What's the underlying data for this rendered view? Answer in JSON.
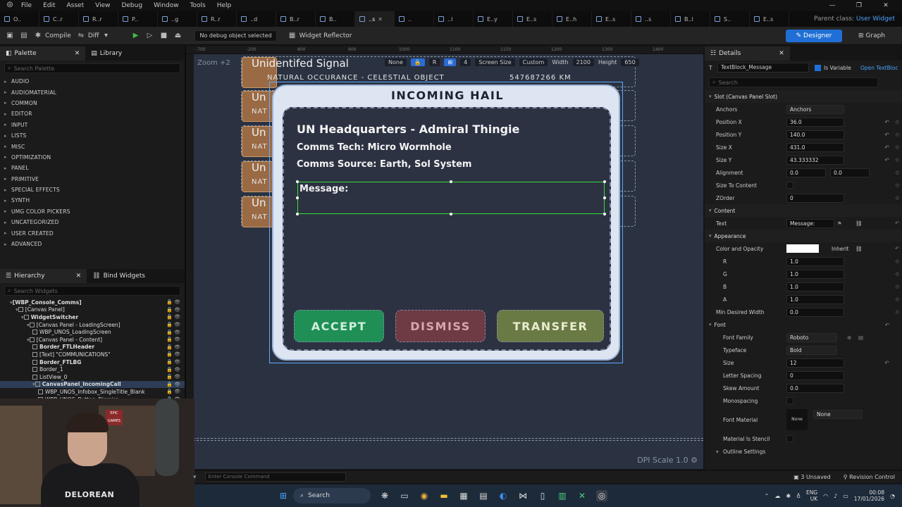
{
  "menubar": {
    "items": [
      "File",
      "Edit",
      "Asset",
      "View",
      "Debug",
      "Window",
      "Tools",
      "Help"
    ]
  },
  "tabs": [
    {
      "label": "O..",
      "active": false
    },
    {
      "label": "C..r",
      "active": false
    },
    {
      "label": "R..r",
      "active": false
    },
    {
      "label": "P..",
      "active": false
    },
    {
      "label": "..g",
      "active": false
    },
    {
      "label": "R..r",
      "active": false
    },
    {
      "label": "..d",
      "active": false
    },
    {
      "label": "B..r",
      "active": false
    },
    {
      "label": "B..",
      "active": false
    },
    {
      "label": "..s",
      "active": true
    },
    {
      "label": "..",
      "active": false
    },
    {
      "label": "..l",
      "active": false
    },
    {
      "label": "E..y",
      "active": false
    },
    {
      "label": "E..s",
      "active": false
    },
    {
      "label": "E..h",
      "active": false
    },
    {
      "label": "E..s",
      "active": false
    },
    {
      "label": "..s",
      "active": false
    },
    {
      "label": "B..l",
      "active": false
    },
    {
      "label": "S..",
      "active": false
    },
    {
      "label": "E..s",
      "active": false
    }
  ],
  "parent_class": {
    "label": "Parent class:",
    "value": "User Widget"
  },
  "toolbar": {
    "compile": "Compile",
    "diff": "Diff",
    "debug_select": "No debug object selected",
    "widget_reflector": "Widget Reflector",
    "designer": "Designer",
    "graph": "Graph"
  },
  "palette": {
    "tab": "Palette",
    "library_tab": "Library",
    "search_placeholder": "Search Palette",
    "categories": [
      "AUDIO",
      "AUDIOMATERIAL",
      "COMMON",
      "EDITOR",
      "INPUT",
      "LISTS",
      "MISC",
      "OPTIMIZATION",
      "PANEL",
      "PRIMITIVE",
      "SPECIAL EFFECTS",
      "SYNTH",
      "UMG COLOR PICKERS",
      "UNCATEGORIZED",
      "USER CREATED",
      "ADVANCED"
    ]
  },
  "hierarchy": {
    "tab": "Hierarchy",
    "bind_tab": "Bind Widgets",
    "search_placeholder": "Search Widgets",
    "rows": [
      {
        "label": "[WBP_Console_Comms]",
        "indent": 0,
        "bold": true
      },
      {
        "label": "[Canvas Panel]",
        "indent": 1,
        "bold": false
      },
      {
        "label": "WidgetSwitcher",
        "indent": 2,
        "bold": true
      },
      {
        "label": "[Canvas Panel - LoadingScreen]",
        "indent": 3,
        "bold": false
      },
      {
        "label": "WBP_UNOS_LoadingScreen",
        "indent": 4,
        "bold": false
      },
      {
        "label": "[Canvas Panel - Content]",
        "indent": 3,
        "bold": false
      },
      {
        "label": "Border_FTLHeader",
        "indent": 4,
        "bold": true
      },
      {
        "label": "[Text] \"COMMUNICATIONS\"",
        "indent": 4,
        "bold": false
      },
      {
        "label": "Border_FTLBG",
        "indent": 4,
        "bold": true
      },
      {
        "label": "Border_1",
        "indent": 4,
        "bold": false
      },
      {
        "label": "ListView_0",
        "indent": 4,
        "bold": false
      },
      {
        "label": "CanvasPanel_IncomingCall",
        "indent": 4,
        "bold": true
      },
      {
        "label": "WBP_UNOS_Infobox_SingleTitle_Blank",
        "indent": 5,
        "bold": false
      },
      {
        "label": "WBP_UNOS_Button_Dismiss",
        "indent": 5,
        "bold": false
      }
    ]
  },
  "viewport": {
    "zoom": "Zoom +2",
    "dpi": "DPI Scale 1.0",
    "overlay": {
      "none": "None",
      "r": "R",
      "four": "4",
      "screen_size": "Screen Size",
      "custom": "Custom",
      "width_label": "Width",
      "width_value": "2100",
      "height_label": "Height",
      "height_value": "650"
    },
    "ruler_ticks": [
      "-700",
      "-200",
      "800",
      "900",
      "1000",
      "1100",
      "1150",
      "1200",
      "1300",
      "1400"
    ],
    "bg_cards": [
      {
        "title": "Unidentifed Signal",
        "sub": "NATURAL OCCURANCE - CELESTIAL OBJECT",
        "extra": "547687266 KM"
      },
      {
        "title": "Un",
        "sub": "NAT"
      },
      {
        "title": "Un",
        "sub": "NAT"
      },
      {
        "title": "Un",
        "sub": "NAT"
      },
      {
        "title": "Un",
        "sub": "NAT"
      }
    ],
    "hail": {
      "title": "INCOMING HAIL",
      "line1": "UN Headquarters - Admiral Thingie",
      "line2": "Comms Tech: Micro Wormhole",
      "line3": "Comms Source: Earth, Sol System",
      "message_label": "Message:",
      "accept": "ACCEPT",
      "dismiss": "DISMISS",
      "transfer": "TRANSFER"
    }
  },
  "details": {
    "tab": "Details",
    "widget_name": "TextBlock_Message",
    "is_variable": "Is Variable",
    "open_link": "Open TextBloc",
    "search_placeholder": "Search",
    "sections": {
      "slot": "Slot (Canvas Panel Slot)",
      "content": "Content",
      "appearance": "Appearance",
      "font": "Font"
    },
    "slot": {
      "anchors_label": "Anchors",
      "anchors_value": "Anchors",
      "pos_x_label": "Position X",
      "pos_x": "36.0",
      "pos_y_label": "Position Y",
      "pos_y": "140.0",
      "size_x_label": "Size X",
      "size_x": "431.0",
      "size_y_label": "Size Y",
      "size_y": "43.333332",
      "alignment_label": "Alignment",
      "align_x": "0.0",
      "align_y": "0.0",
      "size_to_content": "Size To Content",
      "zorder_label": "ZOrder",
      "zorder": "0"
    },
    "content": {
      "text_label": "Text",
      "text_value": "Message:"
    },
    "appearance": {
      "color_label": "Color and Opacity",
      "inherit": "Inherit",
      "r_label": "R",
      "r": "1.0",
      "g_label": "G",
      "g": "1.0",
      "b_label": "B",
      "b": "1.0",
      "a_label": "A",
      "a": "1.0",
      "min_desired_label": "Min Desired Width",
      "min_desired": "0.0"
    },
    "font": {
      "family_label": "Font Family",
      "family": "Roboto",
      "typeface_label": "Typeface",
      "typeface": "Bold",
      "size_label": "Size",
      "size": "12",
      "letter_spacing_label": "Letter Spacing",
      "letter_spacing": "0",
      "skew_label": "Skew Amount",
      "skew": "0.0",
      "mono_label": "Monospacing",
      "material_label": "Font Material",
      "material_value": "None",
      "material_none": "None",
      "stencil_label": "Material Is Stencil",
      "outline_label": "Outline Settings"
    }
  },
  "console": {
    "placeholder": "Enter Console Command",
    "unsaved": "3 Unsaved",
    "revision": "Revision Control"
  },
  "taskbar": {
    "search": "Search",
    "lang1": "ENG",
    "lang2": "UK",
    "time": "00:08",
    "date": "17/01/2026"
  },
  "webcam": {
    "shirt": "DELOREAN",
    "epic": "EPIC GAMES"
  },
  "colors": {
    "accent": "#1f6fd6",
    "accept": "#1f8f56",
    "dismiss": "#6e3a44",
    "transfer": "#6a7a45",
    "selection": "#36e036"
  }
}
